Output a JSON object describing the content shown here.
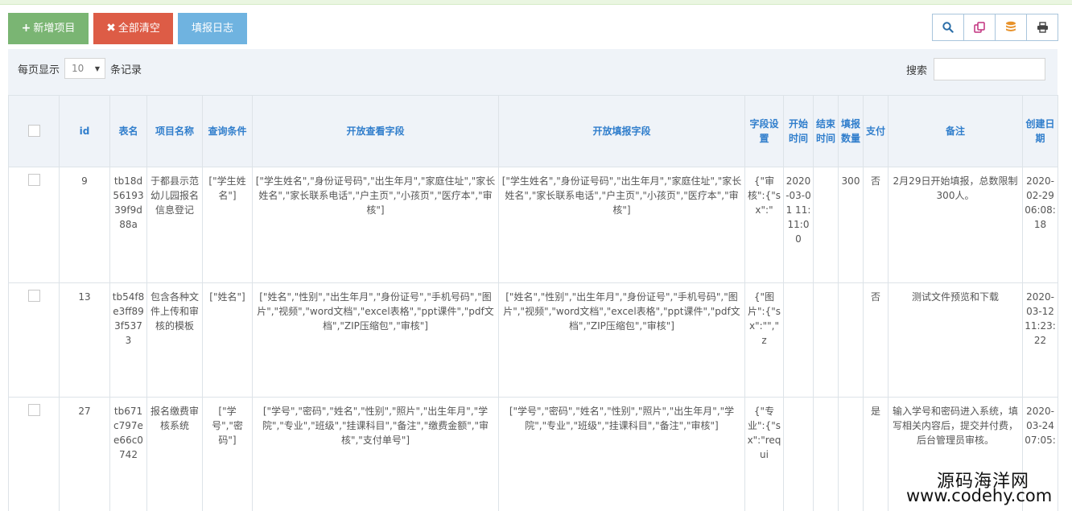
{
  "toolbar": {
    "add_label": "新增项目",
    "clear_label": "全部清空",
    "log_label": "填报日志"
  },
  "tools": {
    "search_icon": "search-icon",
    "copy_icon": "copy-icon",
    "database_icon": "database-icon",
    "print_icon": "print-icon"
  },
  "controls": {
    "per_page_prefix": "每页显示",
    "per_page_value": "10",
    "per_page_suffix": "条记录",
    "search_label": "搜索",
    "search_value": ""
  },
  "table": {
    "headers": [
      "",
      "id",
      "表名",
      "项目名称",
      "查询条件",
      "开放查看字段",
      "开放填报字段",
      "字段设置",
      "开始时间",
      "结束时间",
      "填报数量",
      "支付",
      "备注",
      "创建日期"
    ],
    "rows": [
      {
        "id": "9",
        "table_name": "tb18d5619339f9d88a",
        "project_name": "于都县示范幼儿园报名信息登记",
        "query": "[\"学生姓名\"]",
        "view_fields": "[\"学生姓名\",\"身份证号码\",\"出生年月\",\"家庭住址\",\"家长姓名\",\"家长联系电话\",\"户主页\",\"小孩页\",\"医疗本\",\"审核\"]",
        "fill_fields": "[\"学生姓名\",\"身份证号码\",\"出生年月\",\"家庭住址\",\"家长姓名\",\"家长联系电话\",\"户主页\",\"小孩页\",\"医疗本\",\"审核\"]",
        "field_settings": "{\"审核\":{\"sx\":\"",
        "start_time": "2020-03-01 11:11:00",
        "end_time": "",
        "count": "300",
        "pay": "否",
        "remark": "2月29日开始填报，总数限制300人。",
        "created": "2020-02-29 06:08:18"
      },
      {
        "id": "13",
        "table_name": "tb54f8e3ff893f5373",
        "project_name": "包含各种文件上传和审核的模板",
        "query": "[\"姓名\"]",
        "view_fields": "[\"姓名\",\"性别\",\"出生年月\",\"身份证号\",\"手机号码\",\"图片\",\"视频\",\"word文档\",\"excel表格\",\"ppt课件\",\"pdf文档\",\"ZIP压缩包\",\"审核\"]",
        "fill_fields": "[\"姓名\",\"性别\",\"出生年月\",\"身份证号\",\"手机号码\",\"图片\",\"视频\",\"word文档\",\"excel表格\",\"ppt课件\",\"pdf文档\",\"ZIP压缩包\",\"审核\"]",
        "field_settings": "{\"图片\":{\"sx\":\"\",\"z",
        "start_time": "",
        "end_time": "",
        "count": "",
        "pay": "否",
        "remark": "测试文件预览和下载",
        "created": "2020-03-12 11:23:22"
      },
      {
        "id": "27",
        "table_name": "tb671c797ee66c0742",
        "project_name": "报名缴费审核系统",
        "query": "[\"学号\",\"密码\"]",
        "view_fields": "[\"学号\",\"密码\",\"姓名\",\"性别\",\"照片\",\"出生年月\",\"学院\",\"专业\",\"班级\",\"挂课科目\",\"备注\",\"缴费金额\",\"审核\",\"支付单号\"]",
        "fill_fields": "[\"学号\",\"密码\",\"姓名\",\"性别\",\"照片\",\"出生年月\",\"学院\",\"专业\",\"班级\",\"挂课科目\",\"备注\",\"审核\"]",
        "field_settings": "{\"专业\":{\"sx\":\"requi",
        "start_time": "",
        "end_time": "",
        "count": "",
        "pay": "是",
        "remark": "输入学号和密码进入系统，填写相关内容后，提交并付费，后台管理员审核。",
        "created": "2020-03-24 07:05:"
      }
    ]
  },
  "watermark": {
    "line1": "源码海洋网",
    "line2": "www.codehy.com"
  }
}
